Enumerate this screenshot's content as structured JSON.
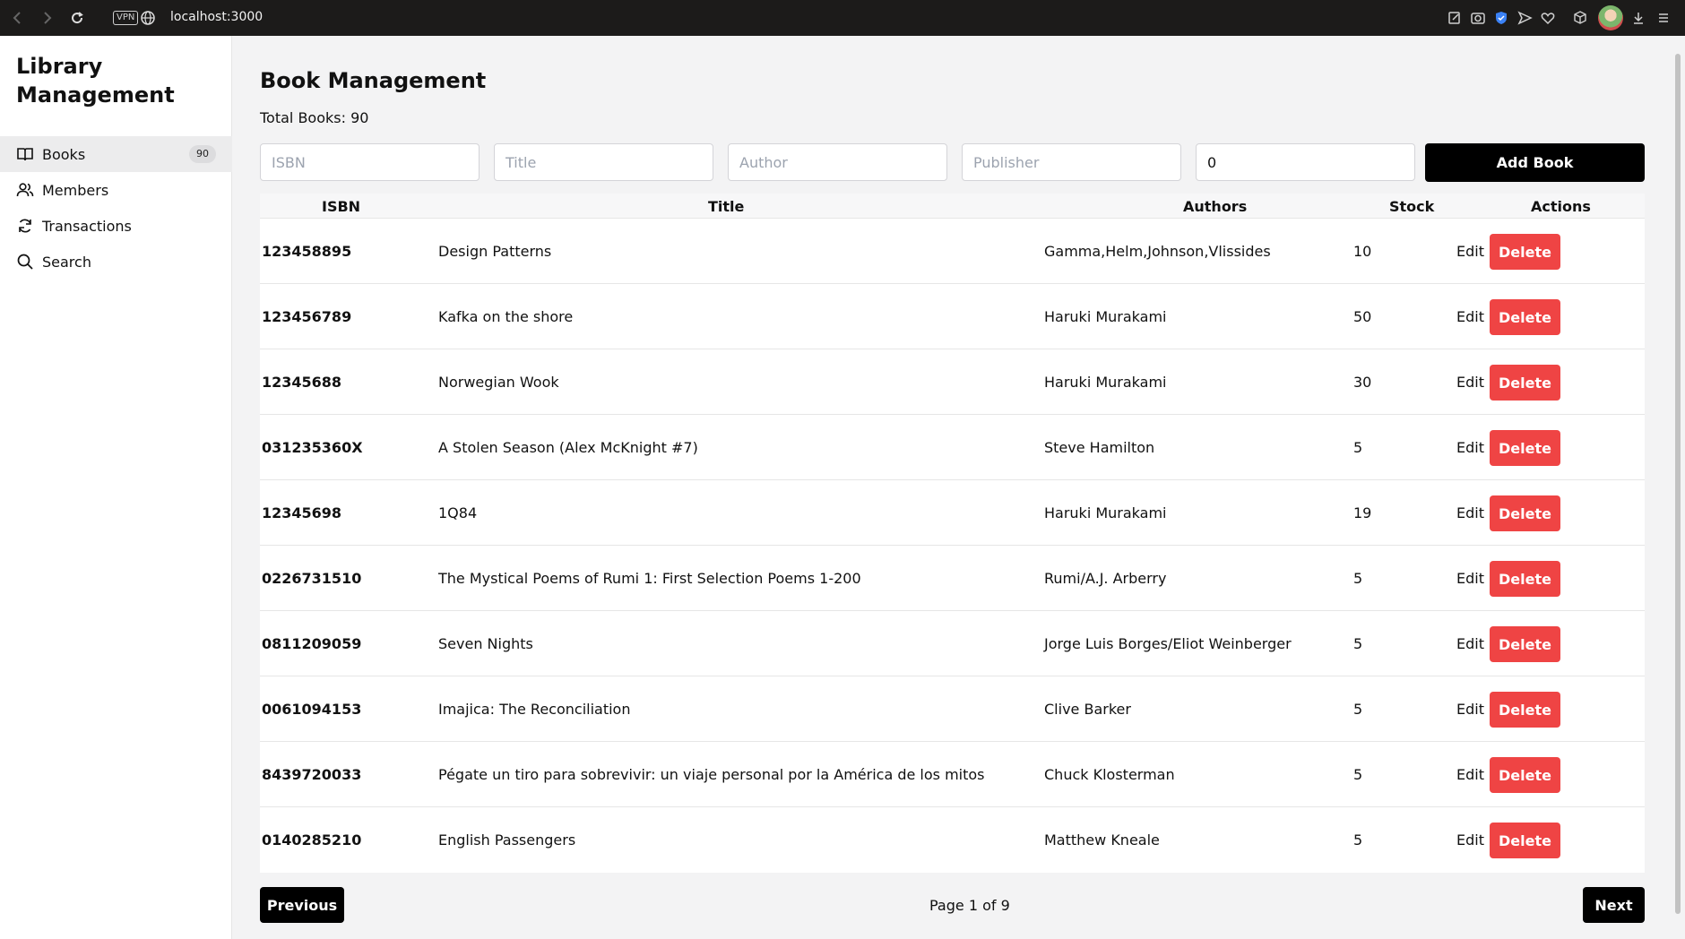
{
  "browser": {
    "url": "localhost:3000",
    "vpn_label": "VPN"
  },
  "sidebar": {
    "title": "Library Management",
    "items": [
      {
        "label": "Books",
        "icon": "book-icon",
        "badge": "90",
        "active": true
      },
      {
        "label": "Members",
        "icon": "users-icon"
      },
      {
        "label": "Transactions",
        "icon": "refresh-icon"
      },
      {
        "label": "Search",
        "icon": "search-icon"
      }
    ]
  },
  "main": {
    "title": "Book Management",
    "total_label": "Total Books: 90",
    "form": {
      "isbn_placeholder": "ISBN",
      "title_placeholder": "Title",
      "author_placeholder": "Author",
      "publisher_placeholder": "Publisher",
      "stock_value": "0",
      "add_label": "Add Book"
    },
    "table": {
      "headers": [
        "ISBN",
        "Title",
        "Authors",
        "Stock",
        "Actions"
      ],
      "edit_label": "Edit",
      "delete_label": "Delete",
      "rows": [
        {
          "isbn": "123458895",
          "title": "Design Patterns",
          "authors": "Gamma,Helm,Johnson,Vlissides",
          "stock": "10"
        },
        {
          "isbn": "123456789",
          "title": "Kafka on the shore",
          "authors": "Haruki Murakami",
          "stock": "50"
        },
        {
          "isbn": "12345688",
          "title": "Norwegian Wook",
          "authors": "Haruki Murakami",
          "stock": "30"
        },
        {
          "isbn": "031235360X",
          "title": "A Stolen Season (Alex McKnight #7)",
          "authors": "Steve Hamilton",
          "stock": "5"
        },
        {
          "isbn": "12345698",
          "title": "1Q84",
          "authors": "Haruki Murakami",
          "stock": "19"
        },
        {
          "isbn": "0226731510",
          "title": "The Mystical Poems of Rumi 1: First Selection Poems 1-200",
          "authors": "Rumi/A.J. Arberry",
          "stock": "5"
        },
        {
          "isbn": "0811209059",
          "title": "Seven Nights",
          "authors": "Jorge Luis Borges/Eliot Weinberger",
          "stock": "5"
        },
        {
          "isbn": "0061094153",
          "title": "Imajica: The Reconciliation",
          "authors": "Clive Barker",
          "stock": "5"
        },
        {
          "isbn": "8439720033",
          "title": "Pégate un tiro para sobrevivir: un viaje personal por la América de los mitos",
          "authors": "Chuck Klosterman",
          "stock": "5"
        },
        {
          "isbn": "0140285210",
          "title": "English Passengers",
          "authors": "Matthew Kneale",
          "stock": "5"
        }
      ]
    },
    "pager": {
      "prev_label": "Previous",
      "next_label": "Next",
      "page_label": "Page 1 of 9"
    }
  },
  "colors": {
    "delete": "#ef4444",
    "primary": "#000000",
    "active_nav": "#ececed"
  }
}
